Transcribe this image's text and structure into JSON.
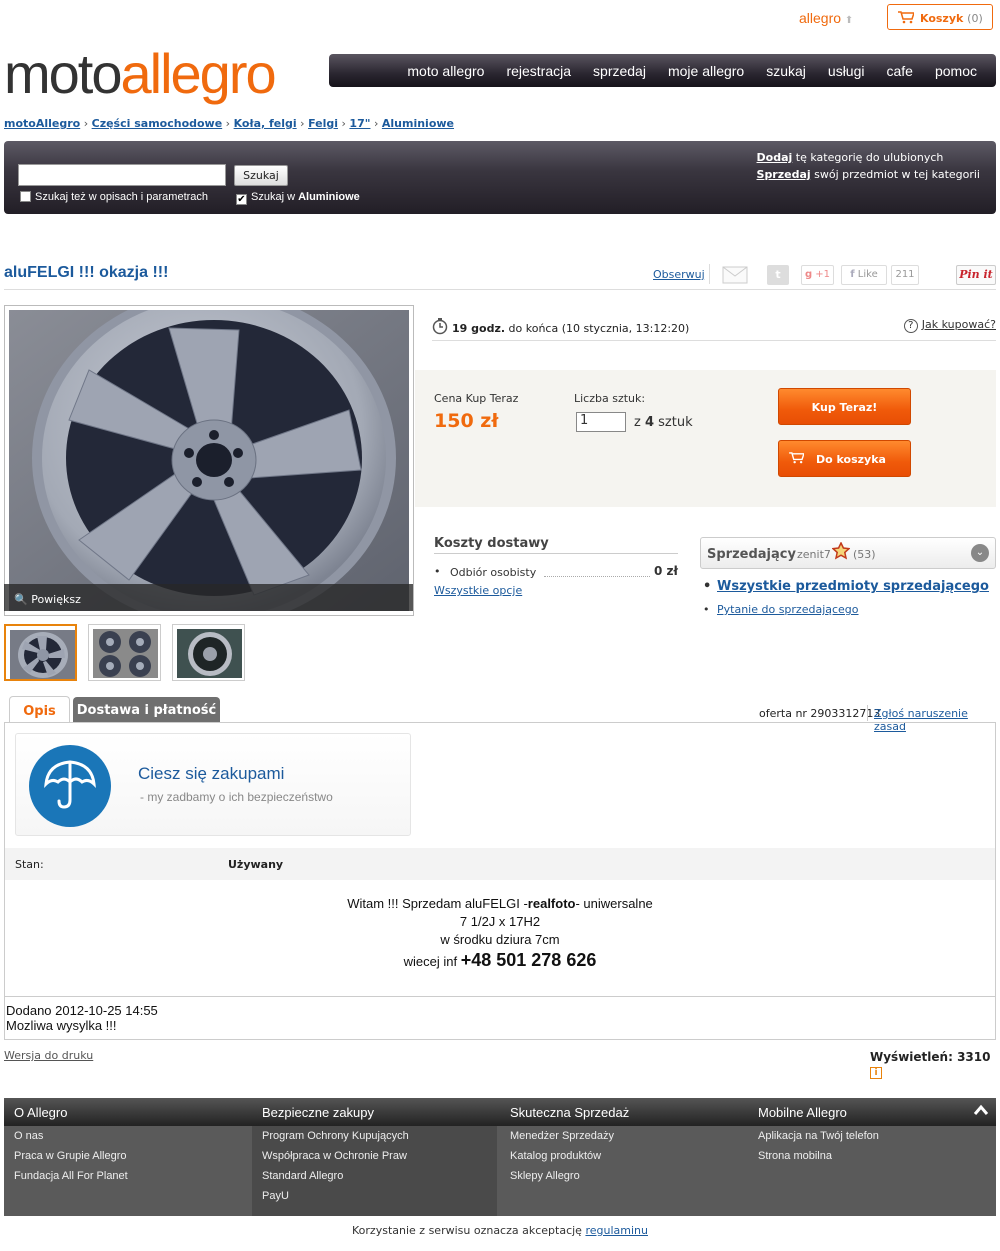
{
  "header": {
    "mini_logo": "allegro",
    "cart_label": "Koszyk",
    "cart_count": "(0)",
    "logo_part1": "moto",
    "logo_part2": "allegro",
    "nav": [
      "moto allegro",
      "rejestracja",
      "sprzedaj",
      "moje allegro",
      "szukaj",
      "usługi",
      "cafe",
      "pomoc"
    ]
  },
  "breadcrumb": [
    "motoAllegro",
    "Części samochodowe",
    "Koła, felgi",
    "Felgi",
    "17\"",
    "Aluminiowe"
  ],
  "search": {
    "button": "Szukaj",
    "opt1": "Szukaj też w opisach i parametrach",
    "opt2_prefix": "Szukaj w ",
    "opt2_category": "Aluminiowe",
    "add_fav_link": "Dodaj",
    "add_fav_text": " tę kategorię do ulubionych",
    "sell_link": "Sprzedaj",
    "sell_text": " swój przedmiot w tej kategorii"
  },
  "item": {
    "title": "aluFELGI !!! okazja !!!",
    "observe": "Obserwuj",
    "gplus": "+1",
    "like": "Like",
    "like_count": "211",
    "pinit": "Pin it",
    "zoom": "Powiększ",
    "time_bold": "19 godz.",
    "time_rest": " do końca (10 stycznia, 13:12:20)",
    "how_to_buy": "Jak kupować?",
    "price_label": "Cena Kup Teraz",
    "price": "150 zł",
    "qty_label": "Liczba sztuk:",
    "qty_value": "1",
    "qty_of": "z",
    "qty_total": "4",
    "qty_unit": "sztuk",
    "buy_now": "Kup Teraz!",
    "to_cart": "Do koszyka"
  },
  "shipping": {
    "title": "Koszty dostawy",
    "method": "Odbiór osobisty",
    "cost": "0 zł",
    "all_options": "Wszystkie opcje"
  },
  "seller": {
    "label": "Sprzedający",
    "name": "zenit7",
    "rating": "(53)",
    "all_items": "Wszystkie przedmioty sprzedającego",
    "question": "Pytanie do sprzedającego"
  },
  "tabs": [
    "Opis",
    "Dostawa i płatność"
  ],
  "offer": {
    "number": "oferta nr 2903312713",
    "report": "Zgłoś naruszenie zasad"
  },
  "protect": {
    "title": "Ciesz się zakupami",
    "subtitle": "-  my zadbamy o ich bezpieczeństwo"
  },
  "condition": {
    "label": "Stan:",
    "value": "Używany"
  },
  "description": {
    "line1_a": "Witam !!! Sprzedam aluFELGI -",
    "line1_b": "realfoto",
    "line1_c": "- uniwersalne",
    "line2": "7 1/2J x 17H2",
    "line3": "w środku dziura 7cm",
    "line4_a": "wiecej inf ",
    "line4_b": "+48 501 278 626"
  },
  "added": {
    "line1": "Dodano 2012-10-25 14:55",
    "line2": "Mozliwa wysylka !!!"
  },
  "print_version": "Wersja do druku",
  "views_label": "Wyświetleń:",
  "views": "3310",
  "footer": {
    "cols": [
      {
        "title": "O Allegro",
        "items": [
          "O nas",
          "Praca w Grupie Allegro",
          "Fundacja All For Planet"
        ]
      },
      {
        "title": "Bezpieczne zakupy",
        "items": [
          "Program Ochrony Kupujących",
          "Współpraca w Ochronie Praw",
          "Standard Allegro",
          "PayU"
        ]
      },
      {
        "title": "Skuteczna Sprzedaż",
        "items": [
          "Menedżer Sprzedaży",
          "Katalog produktów",
          "Sklepy Allegro"
        ]
      },
      {
        "title": "Mobilne Allegro",
        "items": [
          "Aplikacja na Twój telefon",
          "Strona mobilna"
        ]
      }
    ],
    "terms_text": "Korzystanie z serwisu oznacza akceptację ",
    "terms_link": "regulaminu"
  },
  "colors": {
    "accent": "#f06a0e",
    "link": "#1c5a9c",
    "dark": "#2a2630"
  }
}
